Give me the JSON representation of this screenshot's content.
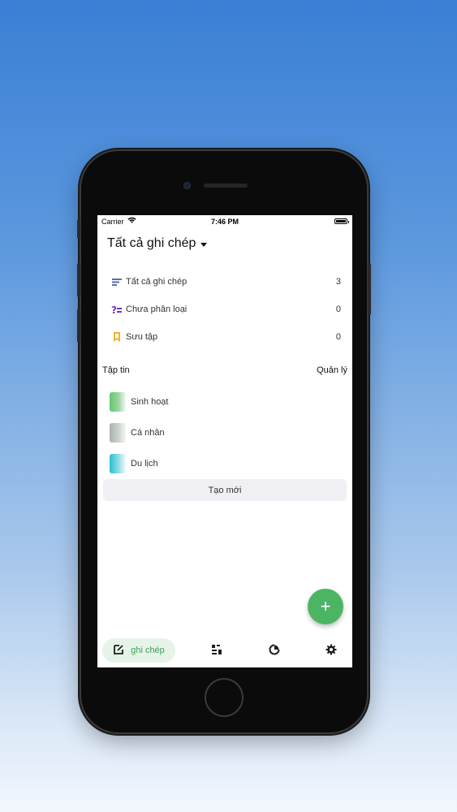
{
  "status_bar": {
    "carrier": "Carrier",
    "time": "7:46 PM"
  },
  "header": {
    "title": "Tất cả ghi chép"
  },
  "categories": [
    {
      "label": "Tất cả ghi chép",
      "count": "3",
      "icon": "list-lines-icon",
      "color": "#5b6ea8"
    },
    {
      "label": "Chưa phân loại",
      "count": "0",
      "icon": "uncategorized-icon",
      "color": "#7a2fc7"
    },
    {
      "label": "Sưu tập",
      "count": "0",
      "icon": "bookmark-icon",
      "color": "#f4b526"
    }
  ],
  "collections": {
    "title": "Tập tin",
    "manage_label": "Quản lý",
    "items": [
      {
        "label": "Sinh hoạt",
        "color": "#62c66d"
      },
      {
        "label": "Cá nhân",
        "color": "#a9b2aa"
      },
      {
        "label": "Du lịch",
        "color": "#27bfd0"
      }
    ],
    "create_label": "Tạo mới"
  },
  "fab": {
    "label": "+"
  },
  "tabbar": {
    "active_label": "ghi chép",
    "accent": "#4cb564",
    "tabs": [
      "note-edit-icon",
      "scan-icon",
      "chart-icon",
      "gear-icon"
    ]
  }
}
